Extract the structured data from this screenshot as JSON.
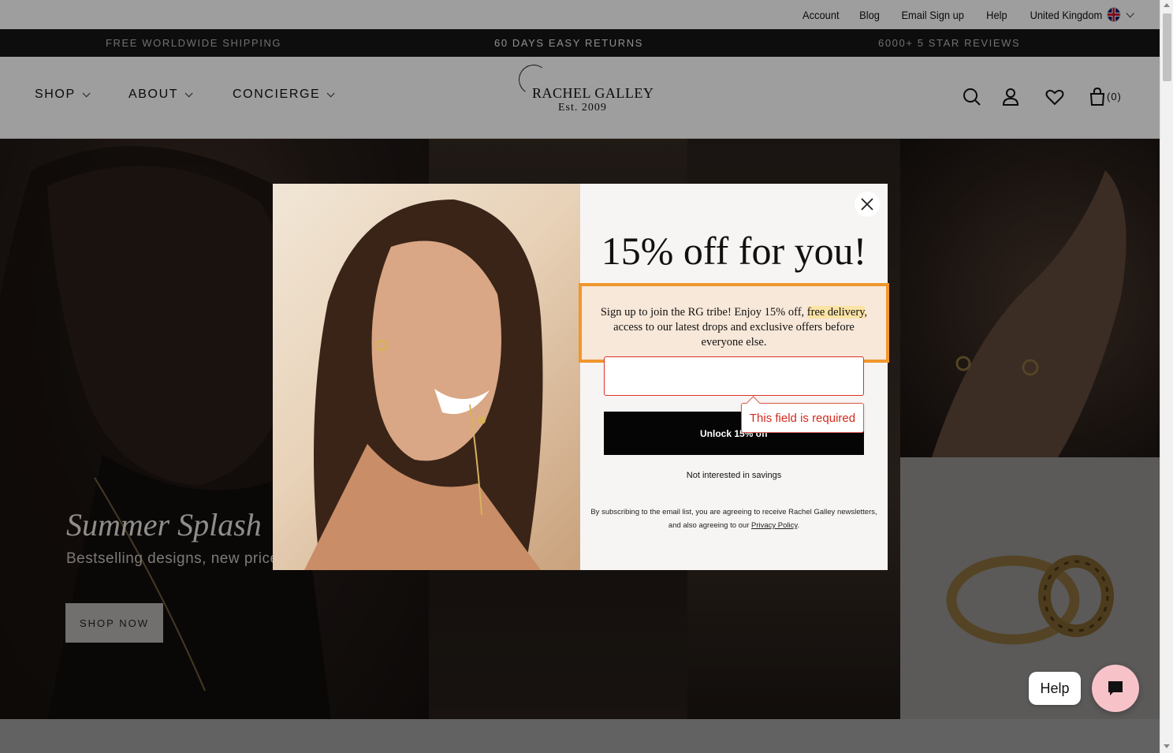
{
  "util_bar": {
    "links": [
      "Account",
      "Blog",
      "Email Sign up",
      "Help"
    ],
    "country": "United Kingdom"
  },
  "promo_strip": {
    "left": "FREE WORLDWIDE SHIPPING",
    "center": "60 DAYS EASY RETURNS",
    "right": "6000+ 5 STAR REVIEWS"
  },
  "header": {
    "nav": [
      "SHOP",
      "ABOUT",
      "CONCIERGE"
    ],
    "logo_name": "RACHEL GALLEY",
    "logo_est": "Est. 2009",
    "cart_count": "(0)"
  },
  "hero": {
    "title": "Summer Splash",
    "subtitle": "Bestselling designs, new prices",
    "button": "SHOP NOW"
  },
  "modal": {
    "title": "15% off for you!",
    "desc_before": "Sign up to join the RG tribe! Enjoy 15% off, ",
    "desc_highlight": "free delivery",
    "desc_after": ", access to our latest drops and exclusive offers before everyone else.",
    "email_value": "",
    "submit_label": "Unlock 15% off",
    "error": "This field is required",
    "decline": "Not interested in savings",
    "legal_text": "By subscribing to the email list, you are agreeing to receive Rachel Galley newsletters, and also agreeing to our ",
    "legal_link": "Privacy Policy",
    "legal_end": "."
  },
  "widgets": {
    "help_label": "Help"
  },
  "colors": {
    "promo_bg": "#161616",
    "highlight_border": "#f0962e",
    "error_red": "#d42a1e",
    "chat_pink": "#f7c3c9"
  }
}
